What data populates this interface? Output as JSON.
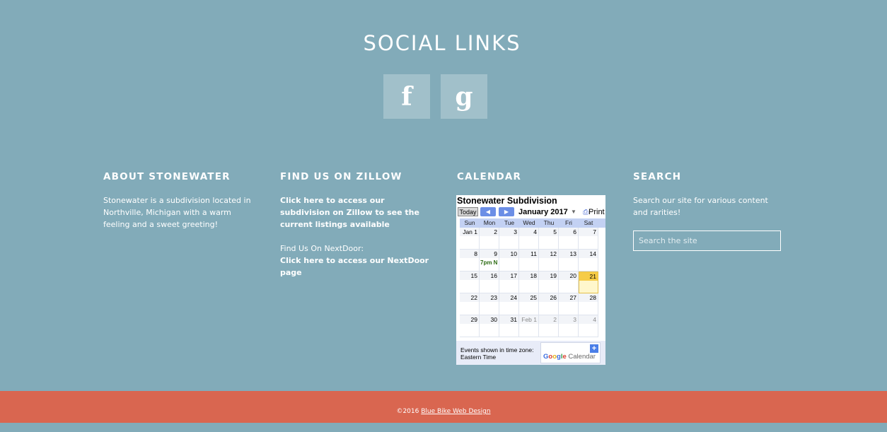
{
  "social": {
    "title": "SOCIAL LINKS",
    "facebook_icon": "f",
    "google_icon": "g"
  },
  "about": {
    "heading": "ABOUT STONEWATER",
    "text": "Stonewater is a subdivision located in Northville, Michigan with a warm feeling and a sweet greeting!"
  },
  "zillow": {
    "heading": "FIND US ON ZILLOW",
    "link_text": "Click here to access our subdivision on Zillow to see the current listings available",
    "nextdoor_label": "Find Us On NextDoor:",
    "nextdoor_link": "Click here to access our NextDoor page"
  },
  "calendar": {
    "heading": "CALENDAR",
    "widget_title": "Stonewater Subdivision",
    "today_label": "Today",
    "prev_icon": "◀",
    "next_icon": "▶",
    "month_label": "January 2017",
    "dropdown_icon": "▼",
    "print_label": "Print",
    "day_names": [
      "Sun",
      "Mon",
      "Tue",
      "Wed",
      "Thu",
      "Fri",
      "Sat"
    ],
    "weeks": [
      [
        {
          "d": "Jan 1"
        },
        {
          "d": "2"
        },
        {
          "d": "3"
        },
        {
          "d": "4"
        },
        {
          "d": "5"
        },
        {
          "d": "6"
        },
        {
          "d": "7"
        }
      ],
      [
        {
          "d": "8"
        },
        {
          "d": "9",
          "event": "7pm N"
        },
        {
          "d": "10"
        },
        {
          "d": "11"
        },
        {
          "d": "12"
        },
        {
          "d": "13"
        },
        {
          "d": "14"
        }
      ],
      [
        {
          "d": "15"
        },
        {
          "d": "16"
        },
        {
          "d": "17"
        },
        {
          "d": "18"
        },
        {
          "d": "19"
        },
        {
          "d": "20"
        },
        {
          "d": "21",
          "today": true
        }
      ],
      [
        {
          "d": "22"
        },
        {
          "d": "23"
        },
        {
          "d": "24"
        },
        {
          "d": "25"
        },
        {
          "d": "26"
        },
        {
          "d": "27"
        },
        {
          "d": "28"
        }
      ],
      [
        {
          "d": "29"
        },
        {
          "d": "30"
        },
        {
          "d": "31"
        },
        {
          "d": "Feb 1",
          "other": true
        },
        {
          "d": "2",
          "other": true
        },
        {
          "d": "3",
          "other": true
        },
        {
          "d": "4",
          "other": true
        }
      ]
    ],
    "tz_line1": "Events shown in time zone:",
    "tz_line2": "Eastern Time",
    "add_icon": "+",
    "google_word": "Google",
    "calendar_word": "Calendar",
    "today_color": "#f6cc47",
    "event_color": "#2a6a10"
  },
  "search": {
    "heading": "SEARCH",
    "text": "Search our site for various content and rarities!",
    "placeholder": "Search the site"
  },
  "footer": {
    "copyright": "©2016",
    "link_text": "Blue Bike Web Design"
  },
  "colors": {
    "background": "#82abb9",
    "footer": "#d96650"
  }
}
